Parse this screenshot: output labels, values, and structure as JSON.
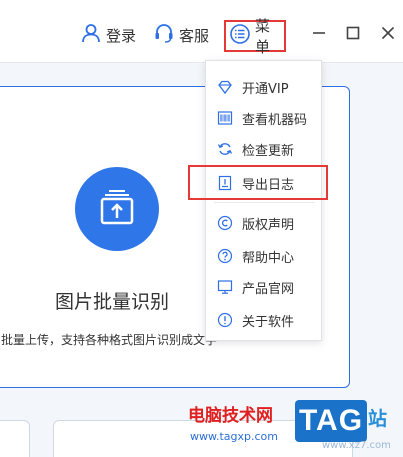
{
  "titlebar": {
    "login_label": "登录",
    "service_label": "客服",
    "menu_label": "菜单"
  },
  "main": {
    "card_title": "图片批量识别",
    "card_subtitle": "批量上传，支持各种格式图片识别成文字"
  },
  "menu": {
    "items": [
      {
        "label": "开通VIP",
        "icon": "diamond-icon"
      },
      {
        "label": "查看机器码",
        "icon": "barcode-icon"
      },
      {
        "label": "检查更新",
        "icon": "refresh-icon"
      },
      {
        "label": "导出日志",
        "icon": "export-log-icon"
      },
      {
        "label": "版权声明",
        "icon": "copyright-icon"
      },
      {
        "label": "帮助中心",
        "icon": "help-icon"
      },
      {
        "label": "产品官网",
        "icon": "monitor-icon"
      },
      {
        "label": "关于软件",
        "icon": "info-icon"
      }
    ]
  },
  "watermark": {
    "site_name": "电脑技术网",
    "url": "www.tagxp.com",
    "tag": "TAG",
    "zhan": "站",
    "url2": "www.xz7.com"
  },
  "colors": {
    "accent": "#2f76e8",
    "highlight": "#e53935"
  }
}
